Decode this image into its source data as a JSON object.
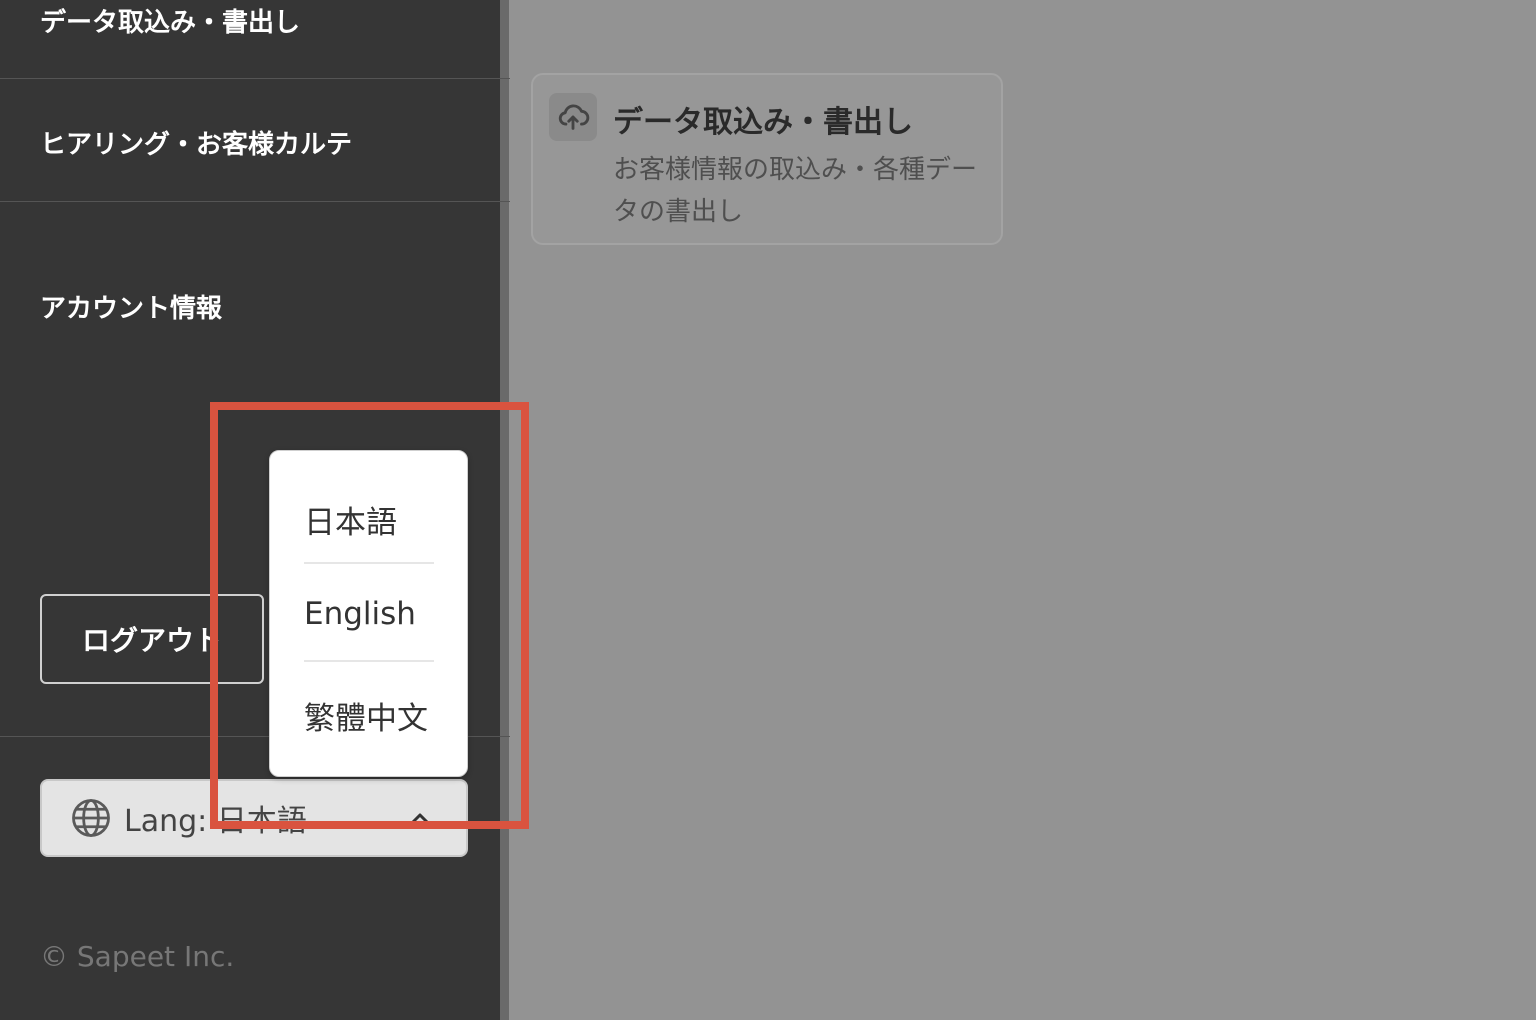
{
  "sidebar": {
    "items": [
      {
        "label": "データ取込み・書出し"
      },
      {
        "label": "ヒアリング・お客様カルテ"
      },
      {
        "label": "アカウント情報"
      }
    ],
    "logout_label": "ログアウト",
    "lang_label": "Lang: 日本語",
    "copyright": "© Sapeet Inc."
  },
  "card": {
    "title": "データ取込み・書出し",
    "description": "お客様情報の取込み・各種データの書出し",
    "icon": "cloud-upload-icon"
  },
  "language_dropdown": {
    "options": [
      {
        "label": "日本語"
      },
      {
        "label": "English"
      },
      {
        "label": "繁體中文"
      }
    ]
  },
  "colors": {
    "sidebar_bg": "#363636",
    "overlay": "#939393",
    "highlight": "#d9533f"
  }
}
